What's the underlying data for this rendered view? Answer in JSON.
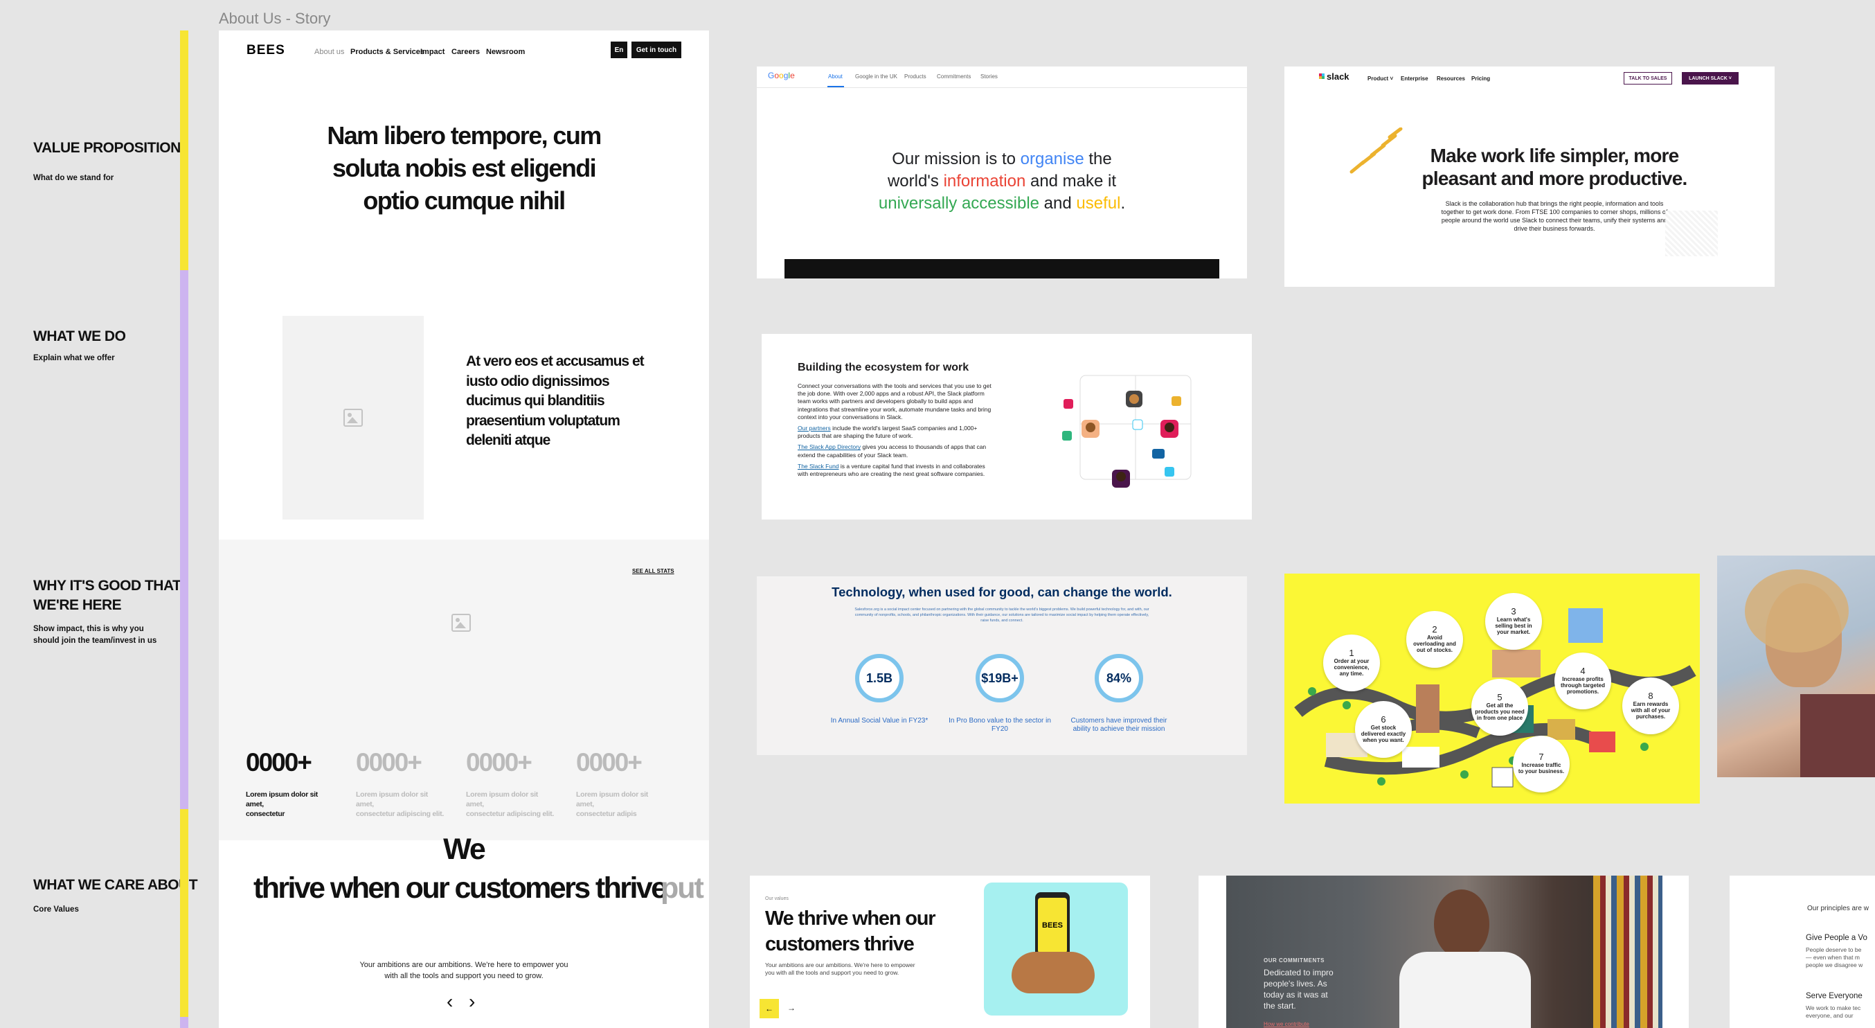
{
  "frame_title": "About Us - Story",
  "sections": [
    {
      "title": "VALUE PROPOSITION",
      "subtitle": "What do we stand for"
    },
    {
      "title": "WHAT WE DO",
      "subtitle": "Explain what we offer"
    },
    {
      "title_line1": "WHY IT'S GOOD THAT",
      "title_line2": "WE'RE HERE",
      "subtitle_line1": "Show impact, this is why you",
      "subtitle_line2": "should join the team/invest in us"
    },
    {
      "title": "WHAT WE CARE ABOUT",
      "subtitle": "Core Values"
    }
  ],
  "colors": {
    "yellow": "#f7e533",
    "purple": "#cdb4f0",
    "slack_purple": "#4a154b",
    "google_blue": "#4285f4"
  },
  "wireframe": {
    "logo": "BEES",
    "nav": [
      "About us",
      "Products & Services",
      "Impact",
      "Careers",
      "Newsroom"
    ],
    "lang": "En",
    "cta": "Get in touch",
    "hero": [
      "Nam libero tempore, cum",
      "soluta nobis est eligendi",
      "optio cumque nihil"
    ],
    "what_we_do": [
      "At vero eos et accusamus et",
      "iusto odio dignissimos",
      "ducimus qui blanditiis",
      "praesentium voluptatum",
      "deleniti atque"
    ],
    "see_all_stats": "SEE ALL STATS",
    "stats": [
      {
        "value": "0000+",
        "label_line1": "Lorem ipsum dolor sit amet,",
        "label_line2": "consectetur"
      },
      {
        "value": "0000+",
        "label_line1": "Lorem ipsum dolor sit amet,",
        "label_line2": "consectetur adipiscing elit."
      },
      {
        "value": "0000+",
        "label_line1": "Lorem ipsum dolor sit amet,",
        "label_line2": "consectetur adipiscing elit."
      },
      {
        "value": "0000+",
        "label_line1": "Lorem ipsum dolor sit amet,",
        "label_line2": "consectetur adipis"
      }
    ],
    "values_we": "We",
    "values_headline": "thrive when our customers thrive",
    "values_next": "put t",
    "values_body_line1": "Your ambitions are our ambitions. We're here to empower you",
    "values_body_line2": "with all the tools and support you need to grow.",
    "prev": "‹",
    "next": "›"
  },
  "google": {
    "logo": "Google",
    "nav": [
      "About",
      "Google in the UK",
      "Products",
      "Commitments",
      "Stories"
    ],
    "line1_a": "Our mission is to ",
    "line1_b": "organise",
    "line1_c": " the",
    "line2_a": "world's ",
    "line2_b": "information",
    "line2_c": " and make it",
    "line3_a": "universally accessible",
    "line3_b": " and ",
    "line3_c": "useful",
    "line3_d": "."
  },
  "slack": {
    "logo": "slack",
    "nav": [
      "Product ˅",
      "Enterprise",
      "Resources",
      "Pricing"
    ],
    "talk": "TALK TO SALES",
    "launch": "LAUNCH SLACK ˅",
    "headline1": "Make work life simpler, more",
    "headline2": "pleasant and more productive.",
    "body": [
      "Slack is the collaboration hub that brings the right people, information and tools",
      "together to get work done. From FTSE 100 companies to corner shops, millions of",
      "people around the world use Slack to connect their teams, unify their systems and",
      "drive their business forwards."
    ]
  },
  "ecosystem": {
    "title": "Building the ecosystem for work",
    "p1": [
      "Connect your conversations with the tools and services that you use to get",
      "the job done. With over 2,000 apps and a robust API, the Slack platform",
      "team works with partners and developers globally to build apps and",
      "integrations that streamline your work, automate mundane tasks and bring",
      "context into your conversations in Slack."
    ],
    "link1": "Our partners",
    "p2a": " include the world's largest SaaS companies and 1,000+",
    "p2b": "products that are shaping the future of work.",
    "link2": "The Slack App Directory",
    "p3a": " gives you access to thousands of apps that can",
    "p3b": "extend the capabilities of your Slack team.",
    "link3": "The Slack Fund",
    "p4a": " is a venture capital fund that invests in and collaborates",
    "p4b": "with entrepreneurs who are creating the next great software companies."
  },
  "salesforce": {
    "title": "Technology, when used for good, can change the world.",
    "body": [
      "Salesforce.org is a social impact center focused on partnering with the global community to tackle the world's biggest problems. We build powerful technology for, and with, our",
      "community of nonprofits, schools, and philanthropic organizations. With their guidance, our solutions are tailored to maximize social impact by helping them operate effectively,",
      "raise funds, and connect."
    ],
    "stats": [
      {
        "value": "1.5B",
        "label1": "In Annual Social Value in FY23*",
        "label2": ""
      },
      {
        "value": "$19B+",
        "label1": "In Pro Bono value to the sector in",
        "label2": "FY20"
      },
      {
        "value": "84%",
        "label1": "Customers have improved their",
        "label2": "ability to achieve their mission"
      }
    ]
  },
  "isometric": {
    "steps": [
      {
        "n": "1",
        "l1": "Order at your",
        "l2": "convenience,",
        "l3": "any time."
      },
      {
        "n": "2",
        "l1": "Avoid",
        "l2": "overloading and",
        "l3": "out of stocks."
      },
      {
        "n": "3",
        "l1": "Learn what's",
        "l2": "selling best in",
        "l3": "your market."
      },
      {
        "n": "4",
        "l1": "Increase profits",
        "l2": "through targeted",
        "l3": "promotions."
      },
      {
        "n": "5",
        "l1": "Get all the",
        "l2": "products you need",
        "l3": "in from one place"
      },
      {
        "n": "6",
        "l1": "Get stock",
        "l2": "delivered exactly",
        "l3": "when you want."
      },
      {
        "n": "7",
        "l1": "Increase traffic",
        "l2": "to your business.",
        "l3": ""
      },
      {
        "n": "8",
        "l1": "Earn rewards",
        "l2": "with all of your",
        "l3": "purchases."
      }
    ]
  },
  "bees_values": {
    "eyebrow": "Our values",
    "headline1": "We thrive when our",
    "headline2": "customers thrive",
    "body1": "Your ambitions are our ambitions. We're here to empower",
    "body2": "you with all the tools and support you need to grow.",
    "logo": "BEES"
  },
  "commitments": {
    "eyebrow": "OUR COMMITMENTS",
    "l1": "Dedicated to impro",
    "l2": "people's lives. As",
    "l3": "today as it was at",
    "l4": "the start.",
    "link": "How we contribute"
  },
  "principles": {
    "intro": "Our principles are w",
    "h1": "Give People a Vo",
    "p1": [
      "People deserve to be",
      "— even when that m",
      "people we disagree w"
    ],
    "h2": "Serve Everyone",
    "p2": [
      "We work to make tec",
      "everyone, and our"
    ]
  }
}
